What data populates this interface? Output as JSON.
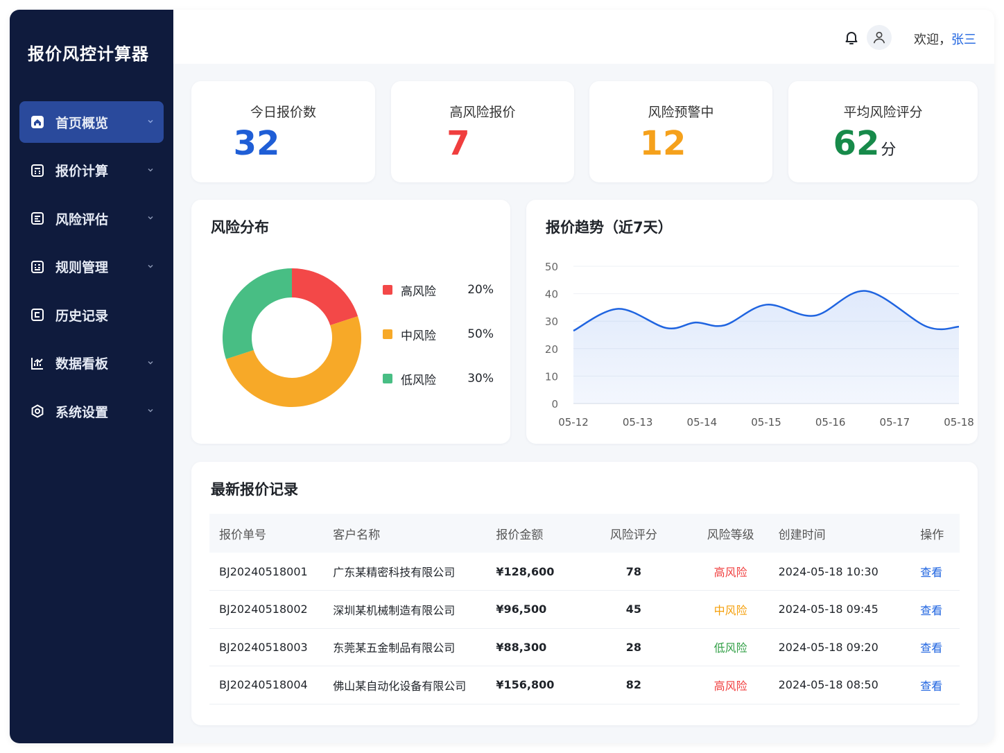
{
  "app": {
    "title": "报价风控计算器"
  },
  "sidebar": {
    "items": [
      {
        "label": "首页概览",
        "icon": "home-icon",
        "active": true
      },
      {
        "label": "报价计算",
        "icon": "calculator-icon"
      },
      {
        "label": "风险评估",
        "icon": "assessment-icon"
      },
      {
        "label": "规则管理",
        "icon": "rules-icon"
      },
      {
        "label": "历史记录",
        "icon": "history-icon"
      },
      {
        "label": "数据看板",
        "icon": "chart-icon"
      },
      {
        "label": "系统设置",
        "icon": "settings-icon"
      }
    ]
  },
  "header": {
    "welcome": "欢迎，",
    "user": "张三"
  },
  "stats": [
    {
      "label": "今日报价数",
      "value": "32",
      "color": "#1f5ed6"
    },
    {
      "label": "高风险报价",
      "value": "7",
      "color": "#f03e3e"
    },
    {
      "label": "风险预警中",
      "value": "12",
      "color": "#f5a11c"
    },
    {
      "label": "平均风险评分",
      "value": "62",
      "unit": "分",
      "color": "#178a4a"
    }
  ],
  "risk_chart": {
    "title": "风险分布",
    "items": [
      {
        "name": "高风险",
        "percent": "20%",
        "value": 20,
        "color": "#f34848"
      },
      {
        "name": "中风险",
        "percent": "50%",
        "value": 50,
        "color": "#f7a928"
      },
      {
        "name": "低风险",
        "percent": "30%",
        "value": 30,
        "color": "#48be84"
      }
    ]
  },
  "trend_chart": {
    "title": "报价趋势（近7天）"
  },
  "chart_data": [
    {
      "type": "pie",
      "title": "风险分布",
      "categories": [
        "高风险",
        "中风险",
        "低风险"
      ],
      "values": [
        20,
        50,
        30
      ],
      "legend": "right"
    },
    {
      "type": "area",
      "title": "报价趋势（近7天）",
      "categories": [
        "05-12",
        "05-13",
        "05-14",
        "05-15",
        "05-16",
        "05-17",
        "05-18"
      ],
      "x_values": [
        0,
        0.5,
        1,
        1.5,
        2,
        2.5,
        3,
        3.5,
        4,
        4.5,
        5,
        5.5,
        6
      ],
      "y_values": [
        26.5,
        34.5,
        27.5,
        29.5,
        28.5,
        36,
        32,
        41,
        28,
        28
      ],
      "x": [
        0,
        0.7,
        1.45,
        1.9,
        2.35,
        3.0,
        3.75,
        4.55,
        5.5,
        6
      ],
      "values": [
        26.5,
        34.5,
        27.5,
        29.5,
        28.5,
        36,
        32,
        41,
        28,
        28
      ],
      "ylim": [
        0,
        50
      ],
      "yticks": [
        0,
        10,
        20,
        30,
        40,
        50
      ],
      "grid": true
    }
  ],
  "table": {
    "title": "最新报价记录",
    "columns": [
      "报价单号",
      "客户名称",
      "报价金额",
      "风险评分",
      "风险等级",
      "创建时间",
      "操作"
    ],
    "rows": [
      {
        "id": "BJ20240518001",
        "customer": "广东某精密科技有限公司",
        "amount": "¥128,600",
        "score": "78",
        "level": "高风险",
        "level_color": "#f03e3e",
        "time": "2024-05-18 10:30",
        "action": "查看"
      },
      {
        "id": "BJ20240518002",
        "customer": "深圳某机械制造有限公司",
        "amount": "¥96,500",
        "score": "45",
        "level": "中风险",
        "level_color": "#f59f0a",
        "time": "2024-05-18 09:45",
        "action": "查看"
      },
      {
        "id": "BJ20240518003",
        "customer": "东莞某五金制品有限公司",
        "amount": "¥88,300",
        "score": "28",
        "level": "低风险",
        "level_color": "#2f9e44",
        "time": "2024-05-18 09:20",
        "action": "查看"
      },
      {
        "id": "BJ20240518004",
        "customer": "佛山某自动化设备有限公司",
        "amount": "¥156,800",
        "score": "82",
        "level": "高风险",
        "level_color": "#f03e3e",
        "time": "2024-05-18 08:50",
        "action": "查看"
      }
    ]
  }
}
